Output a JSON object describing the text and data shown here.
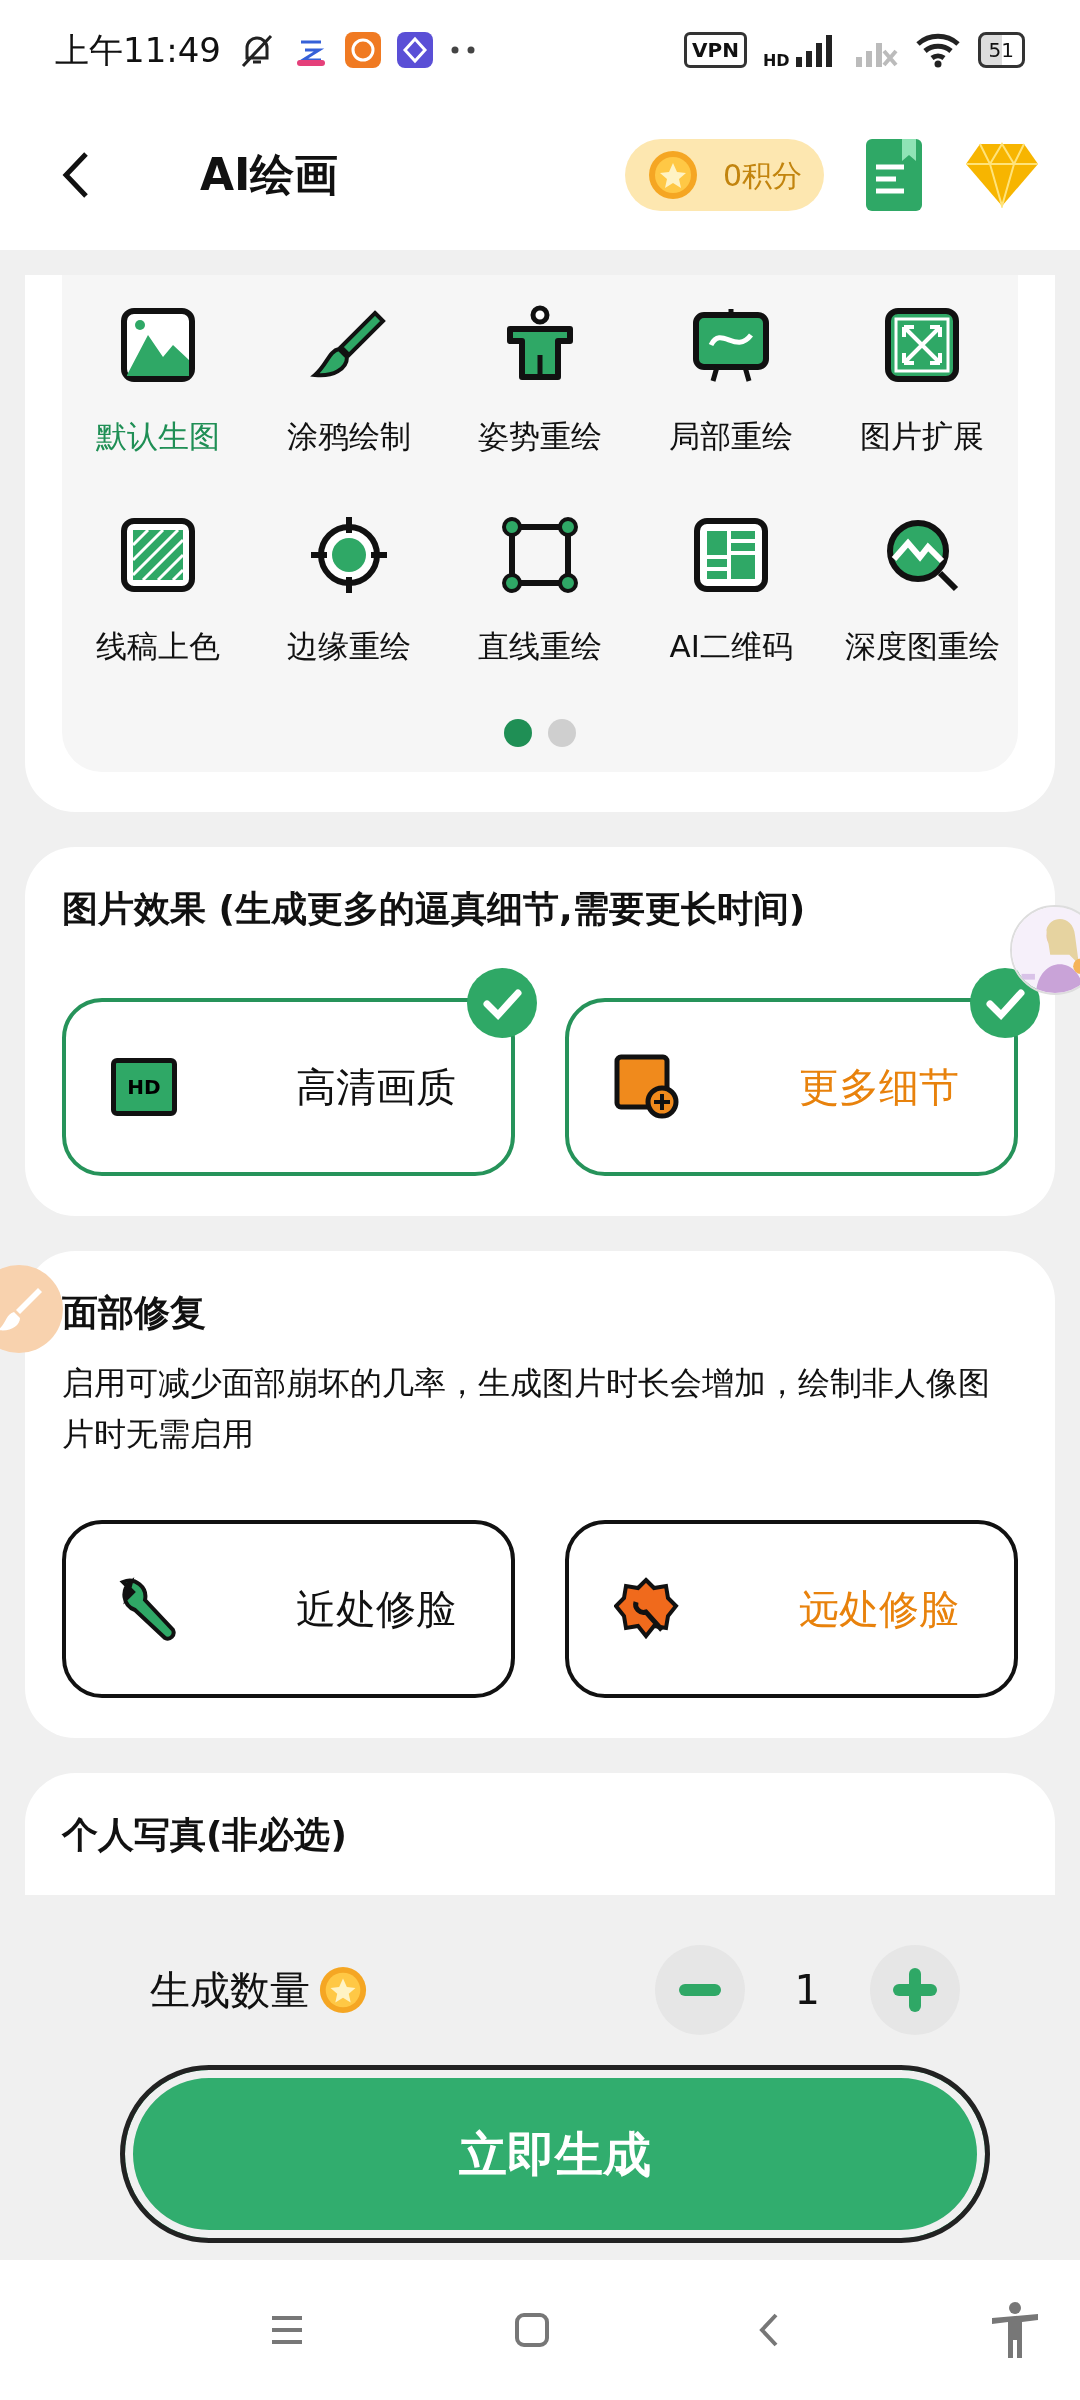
{
  "status_bar": {
    "time": "上午11:49",
    "vpn": "VPN",
    "network": "HD",
    "battery": "51"
  },
  "header": {
    "title": "AI绘画",
    "points": "0积分"
  },
  "modes": [
    {
      "label": "默认生图",
      "selected": true
    },
    {
      "label": "涂鸦绘制",
      "selected": false
    },
    {
      "label": "姿势重绘",
      "selected": false
    },
    {
      "label": "局部重绘",
      "selected": false
    },
    {
      "label": "图片扩展",
      "selected": false
    },
    {
      "label": "线稿上色",
      "selected": false
    },
    {
      "label": "边缘重绘",
      "selected": false
    },
    {
      "label": "直线重绘",
      "selected": false
    },
    {
      "label": "AI二维码",
      "selected": false
    },
    {
      "label": "深度图重绘",
      "selected": false
    }
  ],
  "mode_pages": [
    {
      "selected": true
    },
    {
      "selected": false
    }
  ],
  "image_effect": {
    "title": "图片效果 (生成更多的逼真细节,需要更长时间)",
    "options": [
      {
        "label": "高清画质",
        "checked": true,
        "color": "#111111",
        "icon_text": "HD"
      },
      {
        "label": "更多细节",
        "checked": true,
        "color": "#e8820c"
      }
    ]
  },
  "face_fix": {
    "title": "面部修复",
    "description": "启用可减少面部崩坏的几率，生成图片时长会增加，绘制非人像图片时无需启用",
    "options": [
      {
        "label": "近处修脸",
        "checked": false,
        "color": "#111111"
      },
      {
        "label": "远处修脸",
        "checked": false,
        "color": "#e8820c"
      }
    ]
  },
  "personal_photo": {
    "title": "个人写真(非必选)"
  },
  "quantity": {
    "label": "生成数量",
    "value": "1"
  },
  "generate_button": "立即生成"
}
